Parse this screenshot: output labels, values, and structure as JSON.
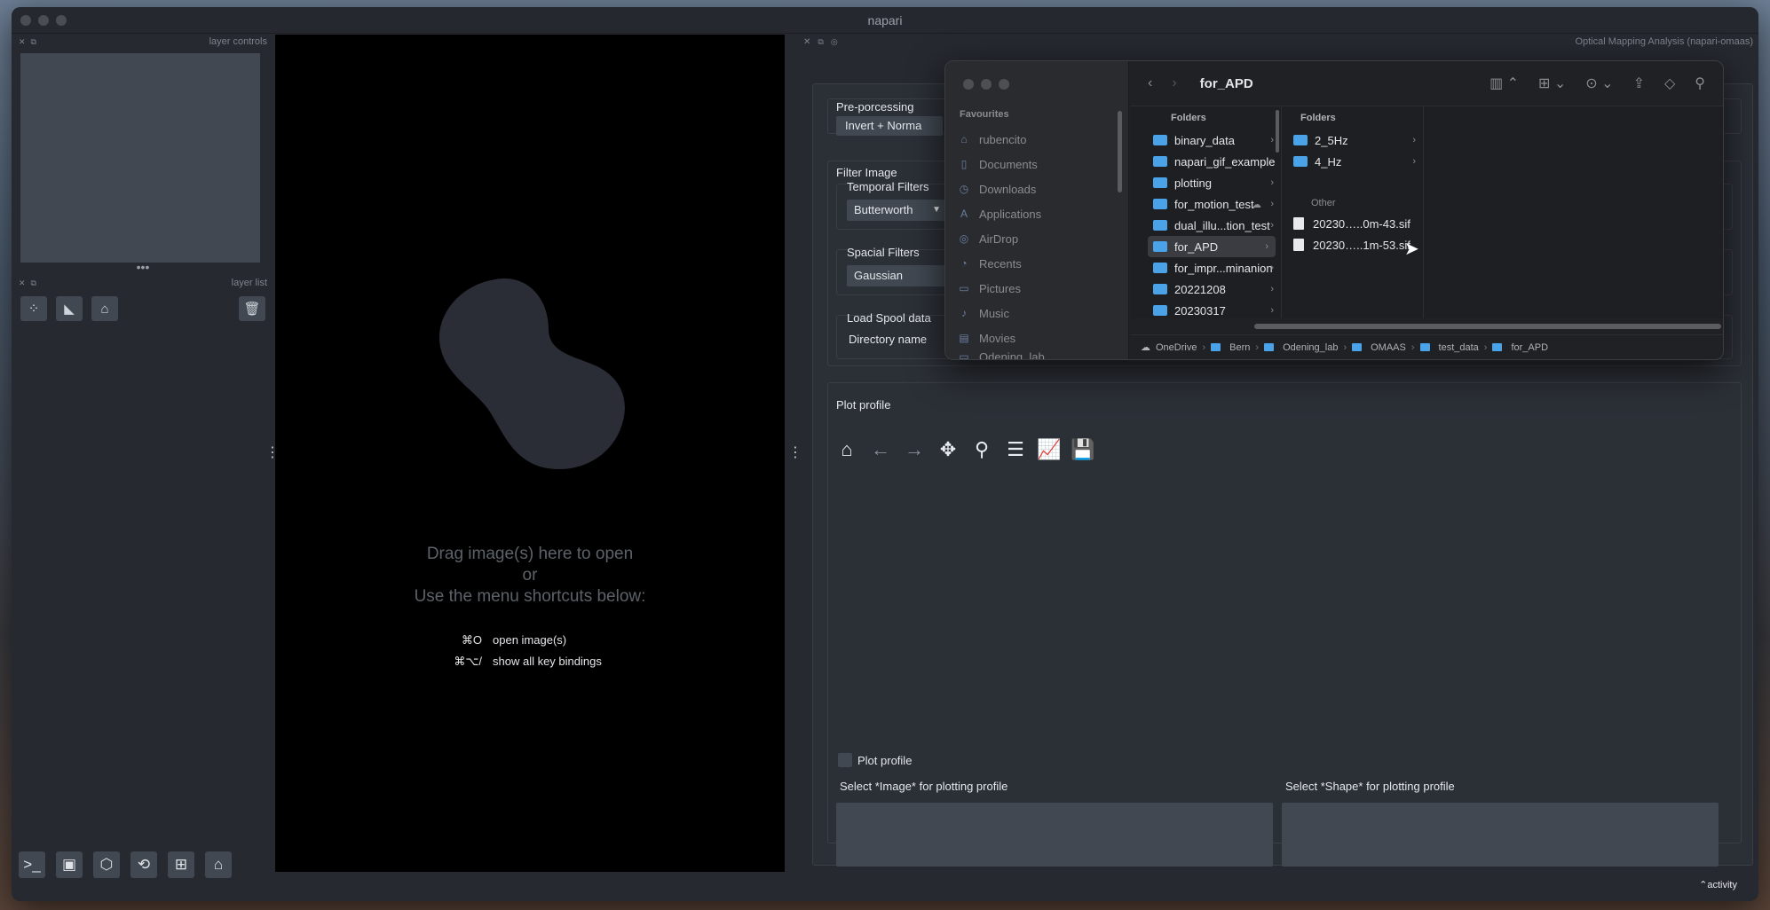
{
  "window": {
    "title": "napari"
  },
  "left_dock": {
    "layer_controls_label": "layer controls",
    "layer_list_label": "layer list"
  },
  "canvas": {
    "welcome_line1": "Drag image(s) here to open",
    "welcome_line2": "or",
    "welcome_line3": "Use the menu shortcuts below:",
    "shortcuts": [
      {
        "key": "⌘O",
        "label": "open image(s)"
      },
      {
        "key": "⌘⌥/",
        "label": "show all key bindings"
      }
    ]
  },
  "right_dock": {
    "title": "Optical Mapping Analysis (napari-omaas)",
    "preprocessing": {
      "title": "Pre-porcessing",
      "button": "Invert + Norma"
    },
    "filter_image": {
      "title": "Filter Image",
      "temporal_label": "Temporal Filters",
      "temporal_value": "Butterworth",
      "spacial_label": "Spacial Filters",
      "spacial_value": "Gaussian"
    },
    "load_spool": {
      "title": "Load Spool data",
      "directory_label": "Directory name"
    },
    "plot_profile": {
      "title": "Plot profile",
      "checkbox_label": "Plot profile",
      "select_image_label": "Select *Image* for plotting profile",
      "select_shape_label": "Select *Shape* for plotting profile"
    },
    "activity": "activity"
  },
  "finder": {
    "title": "for_APD",
    "favourites_header": "Favourites",
    "favourites": [
      {
        "label": "rubencito",
        "icon": "home-icon"
      },
      {
        "label": "Documents",
        "icon": "document-icon"
      },
      {
        "label": "Downloads",
        "icon": "download-icon"
      },
      {
        "label": "Applications",
        "icon": "applications-icon"
      },
      {
        "label": "AirDrop",
        "icon": "airdrop-icon"
      },
      {
        "label": "Recents",
        "icon": "clock-icon"
      },
      {
        "label": "Pictures",
        "icon": "picture-icon"
      },
      {
        "label": "Music",
        "icon": "music-icon"
      },
      {
        "label": "Movies",
        "icon": "movie-icon"
      },
      {
        "label": "Odening_lab",
        "icon": "folder-icon"
      }
    ],
    "col1_header": "Folders",
    "col1": [
      "binary_data",
      "napari_gif_example",
      "plotting",
      "for_motion_test",
      "dual_illu...tion_test",
      "for_APD",
      "for_impr...minanion",
      "20221208",
      "20230317"
    ],
    "col2_header": "Folders",
    "col2_folders": [
      "2_5Hz",
      "4_Hz"
    ],
    "col2_other_header": "Other",
    "col2_files": [
      "20230…..0m-43.sif",
      "20230…..1m-53.sif"
    ],
    "path": [
      "OneDrive",
      "Bern",
      "Odening_lab",
      "OMAAS",
      "test_data",
      "for_APD"
    ]
  }
}
